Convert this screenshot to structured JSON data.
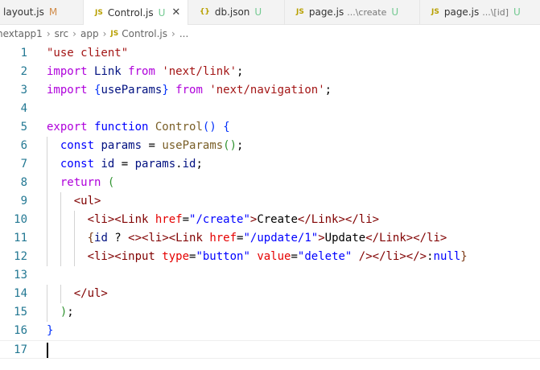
{
  "tabs": [
    {
      "icon": "JS",
      "name": "layout.js",
      "status": "M",
      "suffix": ""
    },
    {
      "icon": "JS",
      "name": "Control.js",
      "status": "U",
      "suffix": "",
      "active": true
    },
    {
      "icon": "{}",
      "name": "db.json",
      "status": "U",
      "suffix": ""
    },
    {
      "icon": "JS",
      "name": "page.js",
      "status": "U",
      "suffix": "...\\create"
    },
    {
      "icon": "JS",
      "name": "page.js",
      "status": "U",
      "suffix": "...\\[id]"
    }
  ],
  "breadcrumb": {
    "parts": [
      "nextapp1",
      "src",
      "app"
    ],
    "file_icon": "JS",
    "file": "Control.js",
    "trail": "..."
  },
  "editor": {
    "active_line": 17,
    "lines": [
      [
        [
          "str",
          "\"use client\""
        ]
      ],
      [
        [
          "ctl",
          "import "
        ],
        [
          "id",
          "Link "
        ],
        [
          "ctl",
          "from "
        ],
        [
          "str",
          "'next/link'"
        ],
        [
          "pl",
          ";"
        ]
      ],
      [
        [
          "ctl",
          "import "
        ],
        [
          "br1",
          "{"
        ],
        [
          "id",
          "useParams"
        ],
        [
          "br1",
          "}"
        ],
        [
          "ctl",
          " from "
        ],
        [
          "str",
          "'next/navigation'"
        ],
        [
          "pl",
          ";"
        ]
      ],
      [],
      [
        [
          "ctl",
          "export "
        ],
        [
          "kw",
          "function "
        ],
        [
          "fn",
          "Control"
        ],
        [
          "br1",
          "()"
        ],
        [
          "pl",
          " "
        ],
        [
          "br1",
          "{"
        ]
      ],
      [
        [
          "pl",
          "  "
        ],
        [
          "kw",
          "const "
        ],
        [
          "id",
          "params"
        ],
        [
          "pl",
          " = "
        ],
        [
          "fn",
          "useParams"
        ],
        [
          "br2",
          "()"
        ],
        [
          "pl",
          ";"
        ]
      ],
      [
        [
          "pl",
          "  "
        ],
        [
          "kw",
          "const "
        ],
        [
          "id",
          "id"
        ],
        [
          "pl",
          " = "
        ],
        [
          "id",
          "params"
        ],
        [
          "pl",
          "."
        ],
        [
          "id",
          "id"
        ],
        [
          "pl",
          ";"
        ]
      ],
      [
        [
          "pl",
          "  "
        ],
        [
          "ctl",
          "return "
        ],
        [
          "br2",
          "("
        ]
      ],
      [
        [
          "pl",
          "    "
        ],
        [
          "tag",
          "<ul>"
        ]
      ],
      [
        [
          "pl",
          "      "
        ],
        [
          "tag",
          "<li><Link "
        ],
        [
          "attr",
          "href"
        ],
        [
          "pl",
          "="
        ],
        [
          "attrv",
          "\"/create\""
        ],
        [
          "tag",
          ">"
        ],
        [
          "pl",
          "Create"
        ],
        [
          "tag",
          "</Link></li>"
        ]
      ],
      [
        [
          "pl",
          "      "
        ],
        [
          "br3",
          "{"
        ],
        [
          "id",
          "id"
        ],
        [
          "pl",
          " ? "
        ],
        [
          "tag",
          "<><li><Link "
        ],
        [
          "attr",
          "href"
        ],
        [
          "pl",
          "="
        ],
        [
          "attrv",
          "\"/update/1\""
        ],
        [
          "tag",
          ">"
        ],
        [
          "pl",
          "Update"
        ],
        [
          "tag",
          "</Link></li>"
        ]
      ],
      [
        [
          "pl",
          "      "
        ],
        [
          "tag",
          "<li><input "
        ],
        [
          "attr",
          "type"
        ],
        [
          "pl",
          "="
        ],
        [
          "attrv",
          "\"button\""
        ],
        [
          "pl",
          " "
        ],
        [
          "attr",
          "value"
        ],
        [
          "pl",
          "="
        ],
        [
          "attrv",
          "\"delete\""
        ],
        [
          "pl",
          " "
        ],
        [
          "tag",
          "/></li></>"
        ],
        [
          "pl",
          ":"
        ],
        [
          "kw",
          "null"
        ],
        [
          "br3",
          "}"
        ]
      ],
      [],
      [
        [
          "pl",
          "    "
        ],
        [
          "tag",
          "</ul>"
        ]
      ],
      [
        [
          "pl",
          "  "
        ],
        [
          "br2",
          ")"
        ],
        [
          "pl",
          ";"
        ]
      ],
      [
        [
          "br1",
          "}"
        ]
      ],
      []
    ]
  }
}
